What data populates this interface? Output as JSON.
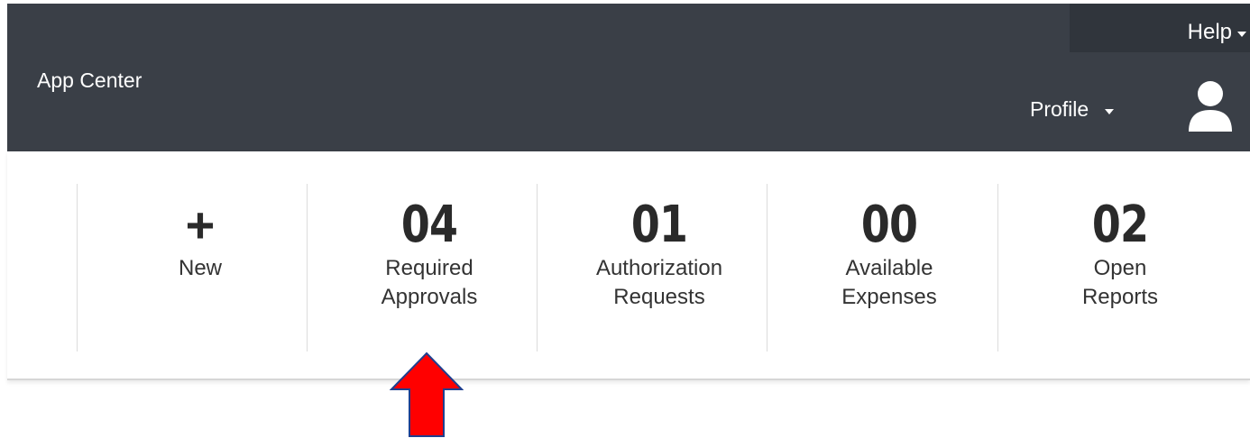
{
  "header": {
    "app_title": "App Center",
    "help_label": "Help",
    "profile_label": "Profile",
    "colors": {
      "header_bg": "#3a3f47",
      "text": "#ffffff"
    }
  },
  "tiles": [
    {
      "count": "+",
      "label_line1": "New",
      "label_line2": ""
    },
    {
      "count": "04",
      "label_line1": "Required",
      "label_line2": "Approvals"
    },
    {
      "count": "01",
      "label_line1": "Authorization",
      "label_line2": "Requests"
    },
    {
      "count": "00",
      "label_line1": "Available",
      "label_line2": "Expenses"
    },
    {
      "count": "02",
      "label_line1": "Open",
      "label_line2": "Reports"
    }
  ],
  "annotation": {
    "arrow_color": "#ff0000",
    "arrow_target": "Required Approvals"
  }
}
